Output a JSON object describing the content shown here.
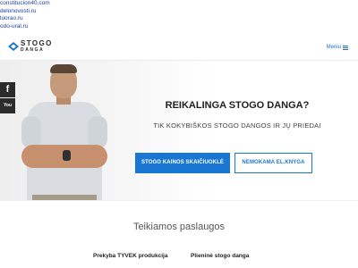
{
  "spam_links": [
    "constitucion40.com",
    "delonovosti.ru",
    "luorao.ru",
    "odo-ural.ru"
  ],
  "header": {
    "logo_top": "STOGO",
    "logo_bottom": "DANGA",
    "menu_label": "Meniu"
  },
  "social": [
    {
      "name": "facebook",
      "icon": "facebook-icon",
      "glyph": "f"
    },
    {
      "name": "youtube",
      "icon": "youtube-icon",
      "glyph": "You"
    }
  ],
  "hero": {
    "title": "REIKALINGA STOGO DANGA?",
    "subtitle": "TIK KOKYBIŠKOS STOGO DANGOS IR JŲ PRIEDAI",
    "primary_button": "STOGO KAINOS SKAIČIUOKLĖ",
    "secondary_button": "NEMOKAMA EL.KNYGA"
  },
  "services": {
    "title": "Teikiamos paslaugos",
    "items": [
      "Prekyba TYVEK produkcija",
      "Plieninė stogo danga"
    ]
  },
  "colors": {
    "accent": "#1976d2",
    "link": "#1a3ea8",
    "social_bg": "#2b2b2b"
  }
}
